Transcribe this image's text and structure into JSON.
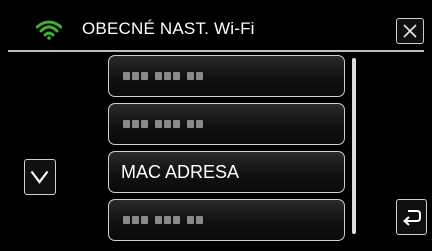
{
  "header": {
    "title": "OBECNÉ NAST. Wi-Fi",
    "status_icon": "wifi-icon",
    "close_icon": "close-icon",
    "accent_color": "#3fae3b"
  },
  "menu": {
    "items": [
      {
        "label": "",
        "obscured": true
      },
      {
        "label": "",
        "obscured": true
      },
      {
        "label": "MAC ADRESA",
        "obscured": false
      },
      {
        "label": "",
        "obscured": true
      }
    ]
  },
  "controls": {
    "scroll_down_icon": "chevron-down-icon",
    "back_icon": "return-icon"
  }
}
